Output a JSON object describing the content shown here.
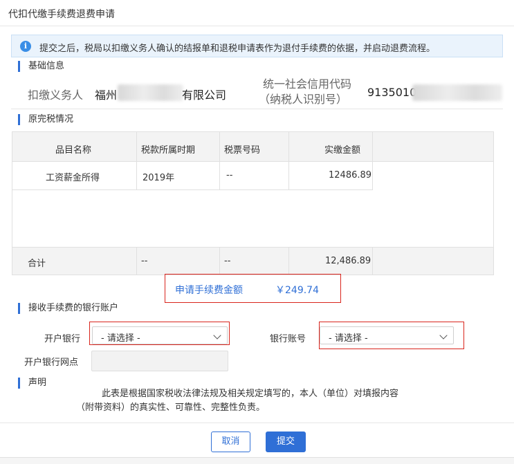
{
  "dialog": {
    "title": "代扣代缴手续费退费申请"
  },
  "notice": {
    "icon": "info-icon",
    "text": "提交之后，税局以扣缴义务人确认的结报单和退税申请表作为退付手续费的依据，并启动退费流程。"
  },
  "basic_info": {
    "section_title": "基础信息",
    "agent_label": "扣缴义务人",
    "agent_name_prefix": "福州",
    "agent_name_suffix": "有限公司",
    "credit_code_label_line1": "统一社会信用代码",
    "credit_code_label_line2": "（纳税人识别号）",
    "credit_code_prefix": "9135010"
  },
  "tax_section": {
    "section_title": "原完税情况",
    "columns": [
      "品目名称",
      "税款所属时期",
      "税票号码",
      "实缴金额"
    ],
    "rows": [
      {
        "item": "工资薪金所得",
        "period": "2019年",
        "ticket": "--",
        "amount": "12486.89"
      }
    ],
    "total": {
      "label": "合计",
      "period": "--",
      "ticket": "--",
      "amount": "12,486.89"
    }
  },
  "fee": {
    "label": "申请手续费金额",
    "amount": "￥249.74"
  },
  "bank": {
    "section_title": "接收手续费的银行账户",
    "bank_label": "开户银行",
    "bank_value": "- 请选择 -",
    "account_label": "银行账号",
    "account_value": "- 请选择 -",
    "branch_label": "开户银行网点",
    "branch_value": ""
  },
  "declaration": {
    "section_title": "声明",
    "line1": "此表是根据国家税收法律法规及相关规定填写的，本人（单位）对填报内容",
    "line2": "（附带资料）的真实性、可靠性、完整性负责。"
  },
  "buttons": {
    "cancel": "取消",
    "submit": "提交"
  },
  "colors": {
    "accent": "#2f6fd6",
    "highlight_border": "#d9241c",
    "notice_bg": "#eaf3fc"
  }
}
